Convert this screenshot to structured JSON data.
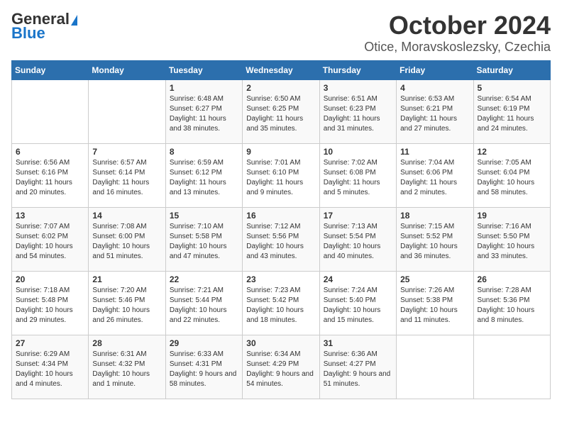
{
  "logo": {
    "text1": "General",
    "text2": "Blue"
  },
  "title": "October 2024",
  "subtitle": "Otice, Moravskoslezsky, Czechia",
  "days_of_week": [
    "Sunday",
    "Monday",
    "Tuesday",
    "Wednesday",
    "Thursday",
    "Friday",
    "Saturday"
  ],
  "weeks": [
    [
      {
        "day": "",
        "info": ""
      },
      {
        "day": "",
        "info": ""
      },
      {
        "day": "1",
        "info": "Sunrise: 6:48 AM\nSunset: 6:27 PM\nDaylight: 11 hours and 38 minutes."
      },
      {
        "day": "2",
        "info": "Sunrise: 6:50 AM\nSunset: 6:25 PM\nDaylight: 11 hours and 35 minutes."
      },
      {
        "day": "3",
        "info": "Sunrise: 6:51 AM\nSunset: 6:23 PM\nDaylight: 11 hours and 31 minutes."
      },
      {
        "day": "4",
        "info": "Sunrise: 6:53 AM\nSunset: 6:21 PM\nDaylight: 11 hours and 27 minutes."
      },
      {
        "day": "5",
        "info": "Sunrise: 6:54 AM\nSunset: 6:19 PM\nDaylight: 11 hours and 24 minutes."
      }
    ],
    [
      {
        "day": "6",
        "info": "Sunrise: 6:56 AM\nSunset: 6:16 PM\nDaylight: 11 hours and 20 minutes."
      },
      {
        "day": "7",
        "info": "Sunrise: 6:57 AM\nSunset: 6:14 PM\nDaylight: 11 hours and 16 minutes."
      },
      {
        "day": "8",
        "info": "Sunrise: 6:59 AM\nSunset: 6:12 PM\nDaylight: 11 hours and 13 minutes."
      },
      {
        "day": "9",
        "info": "Sunrise: 7:01 AM\nSunset: 6:10 PM\nDaylight: 11 hours and 9 minutes."
      },
      {
        "day": "10",
        "info": "Sunrise: 7:02 AM\nSunset: 6:08 PM\nDaylight: 11 hours and 5 minutes."
      },
      {
        "day": "11",
        "info": "Sunrise: 7:04 AM\nSunset: 6:06 PM\nDaylight: 11 hours and 2 minutes."
      },
      {
        "day": "12",
        "info": "Sunrise: 7:05 AM\nSunset: 6:04 PM\nDaylight: 10 hours and 58 minutes."
      }
    ],
    [
      {
        "day": "13",
        "info": "Sunrise: 7:07 AM\nSunset: 6:02 PM\nDaylight: 10 hours and 54 minutes."
      },
      {
        "day": "14",
        "info": "Sunrise: 7:08 AM\nSunset: 6:00 PM\nDaylight: 10 hours and 51 minutes."
      },
      {
        "day": "15",
        "info": "Sunrise: 7:10 AM\nSunset: 5:58 PM\nDaylight: 10 hours and 47 minutes."
      },
      {
        "day": "16",
        "info": "Sunrise: 7:12 AM\nSunset: 5:56 PM\nDaylight: 10 hours and 43 minutes."
      },
      {
        "day": "17",
        "info": "Sunrise: 7:13 AM\nSunset: 5:54 PM\nDaylight: 10 hours and 40 minutes."
      },
      {
        "day": "18",
        "info": "Sunrise: 7:15 AM\nSunset: 5:52 PM\nDaylight: 10 hours and 36 minutes."
      },
      {
        "day": "19",
        "info": "Sunrise: 7:16 AM\nSunset: 5:50 PM\nDaylight: 10 hours and 33 minutes."
      }
    ],
    [
      {
        "day": "20",
        "info": "Sunrise: 7:18 AM\nSunset: 5:48 PM\nDaylight: 10 hours and 29 minutes."
      },
      {
        "day": "21",
        "info": "Sunrise: 7:20 AM\nSunset: 5:46 PM\nDaylight: 10 hours and 26 minutes."
      },
      {
        "day": "22",
        "info": "Sunrise: 7:21 AM\nSunset: 5:44 PM\nDaylight: 10 hours and 22 minutes."
      },
      {
        "day": "23",
        "info": "Sunrise: 7:23 AM\nSunset: 5:42 PM\nDaylight: 10 hours and 18 minutes."
      },
      {
        "day": "24",
        "info": "Sunrise: 7:24 AM\nSunset: 5:40 PM\nDaylight: 10 hours and 15 minutes."
      },
      {
        "day": "25",
        "info": "Sunrise: 7:26 AM\nSunset: 5:38 PM\nDaylight: 10 hours and 11 minutes."
      },
      {
        "day": "26",
        "info": "Sunrise: 7:28 AM\nSunset: 5:36 PM\nDaylight: 10 hours and 8 minutes."
      }
    ],
    [
      {
        "day": "27",
        "info": "Sunrise: 6:29 AM\nSunset: 4:34 PM\nDaylight: 10 hours and 4 minutes."
      },
      {
        "day": "28",
        "info": "Sunrise: 6:31 AM\nSunset: 4:32 PM\nDaylight: 10 hours and 1 minute."
      },
      {
        "day": "29",
        "info": "Sunrise: 6:33 AM\nSunset: 4:31 PM\nDaylight: 9 hours and 58 minutes."
      },
      {
        "day": "30",
        "info": "Sunrise: 6:34 AM\nSunset: 4:29 PM\nDaylight: 9 hours and 54 minutes."
      },
      {
        "day": "31",
        "info": "Sunrise: 6:36 AM\nSunset: 4:27 PM\nDaylight: 9 hours and 51 minutes."
      },
      {
        "day": "",
        "info": ""
      },
      {
        "day": "",
        "info": ""
      }
    ]
  ]
}
